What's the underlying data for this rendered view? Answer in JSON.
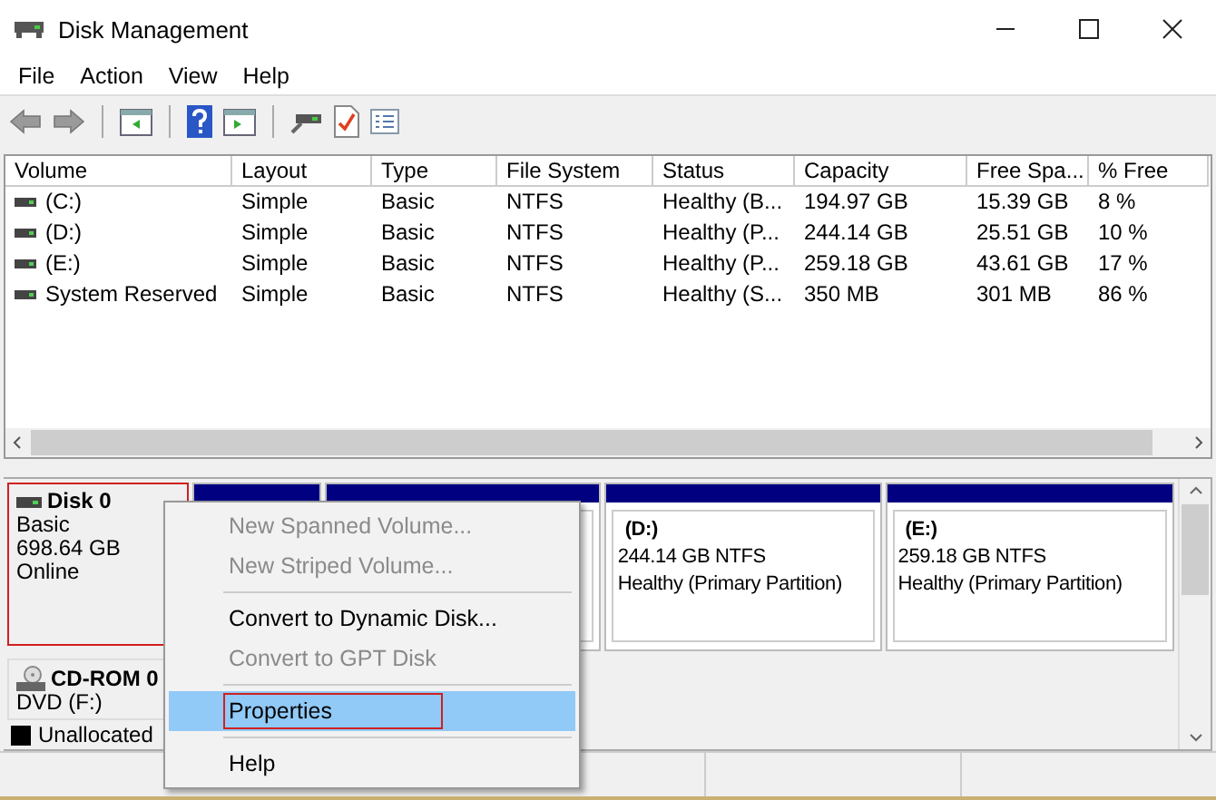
{
  "window": {
    "title": "Disk Management"
  },
  "menu": [
    "File",
    "Action",
    "View",
    "Help"
  ],
  "toolbar": [
    {
      "kind": "back",
      "disabled": true
    },
    {
      "kind": "forward",
      "disabled": true
    },
    {
      "kind": "sep"
    },
    {
      "kind": "tree",
      "disabled": false
    },
    {
      "kind": "sep"
    },
    {
      "kind": "help",
      "disabled": false
    },
    {
      "kind": "pane",
      "disabled": false
    },
    {
      "kind": "sep"
    },
    {
      "kind": "connect",
      "disabled": false
    },
    {
      "kind": "check",
      "disabled": false
    },
    {
      "kind": "list",
      "disabled": false
    }
  ],
  "table": {
    "columns": [
      "Volume",
      "Layout",
      "Type",
      "File System",
      "Status",
      "Capacity",
      "Free Spa...",
      "% Free"
    ],
    "rows": [
      {
        "cells": [
          "(C:)",
          "Simple",
          "Basic",
          "NTFS",
          "Healthy (B...",
          "194.97 GB",
          "15.39 GB",
          "8 %"
        ]
      },
      {
        "cells": [
          "(D:)",
          "Simple",
          "Basic",
          "NTFS",
          "Healthy (P...",
          "244.14 GB",
          "25.51 GB",
          "10 %"
        ]
      },
      {
        "cells": [
          "(E:)",
          "Simple",
          "Basic",
          "NTFS",
          "Healthy (P...",
          "259.18 GB",
          "43.61 GB",
          "17 %"
        ]
      },
      {
        "cells": [
          "System Reserved",
          "Simple",
          "Basic",
          "NTFS",
          "Healthy (S...",
          "350 MB",
          "301 MB",
          "86 %"
        ]
      }
    ]
  },
  "disks": [
    {
      "kind": "disk",
      "name": "Disk 0",
      "lines": [
        "Basic",
        "698.64 GB",
        "Online"
      ],
      "annotated": true,
      "partitions": [
        {
          "kind": "blank"
        },
        {
          "kind": "covered"
        },
        {
          "kind": "volume",
          "label": "(D:)",
          "size": "244.14 GB NTFS",
          "status": "Healthy (Primary Partition)"
        },
        {
          "kind": "volume",
          "label": "(E:)",
          "size": "259.18 GB NTFS",
          "status": "Healthy (Primary Partition)"
        }
      ]
    },
    {
      "kind": "cdrom",
      "name": "CD-ROM 0",
      "lines": [
        "DVD (F:)"
      ],
      "annotated": false
    }
  ],
  "legend": [
    {
      "label": "Unallocated",
      "color": "#000000"
    }
  ],
  "context_menu": [
    {
      "kind": "item",
      "label": "New Spanned Volume...",
      "disabled": true,
      "selected": false,
      "annotated": false
    },
    {
      "kind": "item",
      "label": "New Striped Volume...",
      "disabled": true,
      "selected": false,
      "annotated": false
    },
    {
      "kind": "sep"
    },
    {
      "kind": "item",
      "label": "Convert to Dynamic Disk...",
      "disabled": false,
      "selected": false,
      "annotated": false
    },
    {
      "kind": "item",
      "label": "Convert to GPT Disk",
      "disabled": true,
      "selected": false,
      "annotated": false
    },
    {
      "kind": "sep"
    },
    {
      "kind": "item",
      "label": "Properties",
      "disabled": false,
      "selected": true,
      "annotated": true
    },
    {
      "kind": "sep"
    },
    {
      "kind": "item",
      "label": "Help",
      "disabled": false,
      "selected": false,
      "annotated": false
    }
  ]
}
